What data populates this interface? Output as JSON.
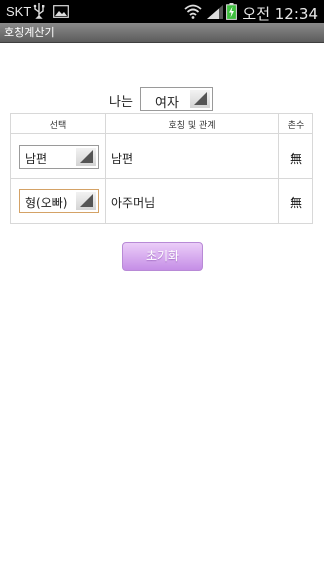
{
  "status_bar": {
    "carrier": "SKT",
    "time": "오전 12:34",
    "icons": [
      "usb-icon",
      "gallery-icon",
      "wifi-icon",
      "signal-icon",
      "battery-charging-icon"
    ]
  },
  "app": {
    "title": "호칭계산기"
  },
  "me": {
    "label": "나는",
    "gender_value": "여자"
  },
  "table": {
    "headers": {
      "select": "선택",
      "relation": "호칭 및 관계",
      "degree": "촌수"
    },
    "rows": [
      {
        "selected": "남편",
        "relation": "남편",
        "degree": "無"
      },
      {
        "selected": "형(오빠)",
        "relation": "아주머님",
        "degree": "無"
      }
    ]
  },
  "reset_button": {
    "label": "초기화"
  },
  "colors": {
    "status_bar_bg": "#000000",
    "title_bar_bg": "#6e6e6e",
    "button_accent": "#c58ee6",
    "focused_select_border": "#d4a266"
  }
}
